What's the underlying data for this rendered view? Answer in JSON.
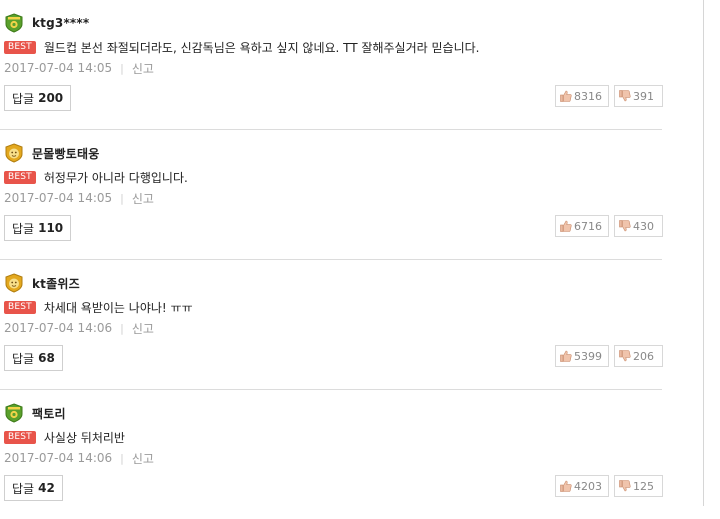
{
  "best_label": "BEST",
  "report_label": "신고",
  "reply_label": "답글",
  "comments": [
    {
      "author": "ktg3****",
      "badge": "green",
      "text": "월드컵 본선 좌절되더라도, 신감독님은 욕하고 싶지 않네요. TT 잘해주실거라 믿습니다.",
      "date": "2017-07-04 14:05",
      "replies": "200",
      "likes": "8316",
      "dislikes": "391"
    },
    {
      "author": "문몰빵토태웅",
      "badge": "gold",
      "text": "허정무가 아니라 다행입니다.",
      "date": "2017-07-04 14:05",
      "replies": "110",
      "likes": "6716",
      "dislikes": "430"
    },
    {
      "author": "kt졸위즈",
      "badge": "gold",
      "text": "차세대 욕받이는 나야나! ㅠㅠ",
      "date": "2017-07-04 14:06",
      "replies": "68",
      "likes": "5399",
      "dislikes": "206"
    },
    {
      "author": "팩토리",
      "badge": "green",
      "text": "사실상 뒤처리반",
      "date": "2017-07-04 14:06",
      "replies": "42",
      "likes": "4203",
      "dislikes": "125"
    }
  ],
  "colors": {
    "best_badge": "#e8544a",
    "green_badge": "#5aa02c",
    "gold_badge": "#e3a81e"
  }
}
